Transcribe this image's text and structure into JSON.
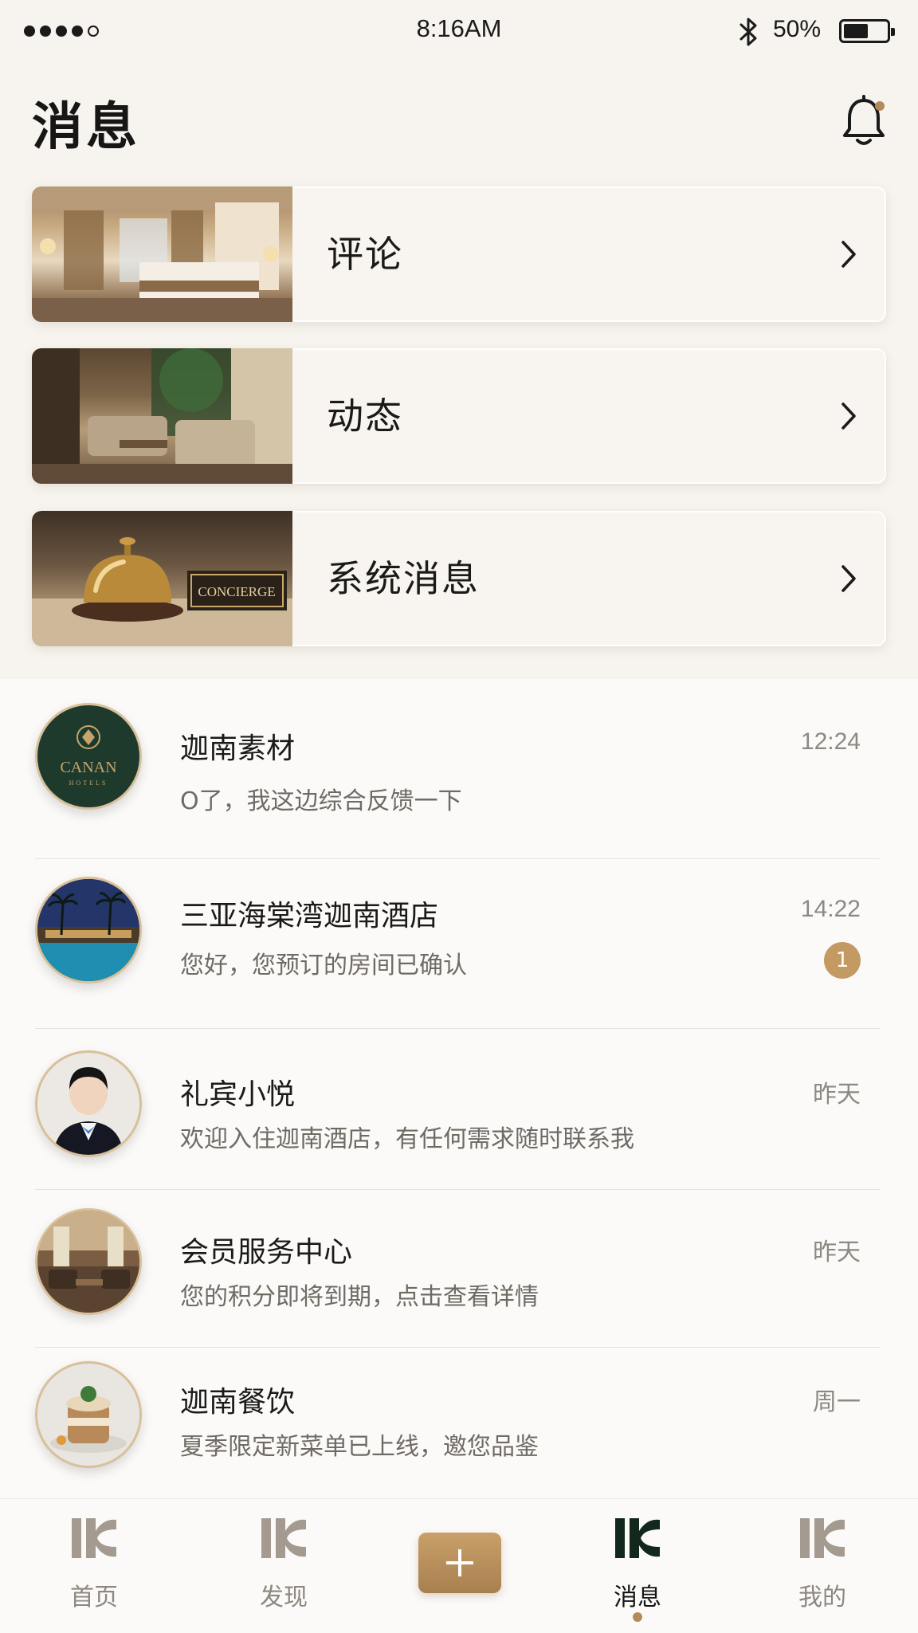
{
  "status_bar": {
    "time": "8:16AM",
    "battery_percent": "50%",
    "signal_bars_filled": 4,
    "signal_bars_total": 5,
    "battery_level": 0.5
  },
  "header": {
    "title": "消息",
    "bell_icon": "bell-icon",
    "has_notification_dot": true
  },
  "categories": [
    {
      "label": "评论",
      "image": "hotel-room-image"
    },
    {
      "label": "动态",
      "image": "hotel-lobby-image"
    },
    {
      "label": "系统消息",
      "image": "concierge-bell-image",
      "image_text": "CONCIERGE"
    }
  ],
  "messages": [
    {
      "name": "迦南素材",
      "preview": "O了，我这边综合反馈一下",
      "time": "12:24",
      "avatar": "canan-hotels-logo",
      "avatar_text": "CANAN",
      "avatar_subtext": "HOTELS"
    },
    {
      "name": "三亚海棠湾迦南酒店",
      "preview": "您好，您预订的房间已确认",
      "time": "14:22",
      "badge": "1",
      "avatar": "resort-pool-photo"
    },
    {
      "name": "礼宾小悦",
      "preview": "欢迎入住迦南酒店，有任何需求随时联系我",
      "time": "昨天",
      "avatar": "concierge-staff-photo"
    },
    {
      "name": "会员服务中心",
      "preview": "您的积分即将到期，点击查看详情",
      "time": "昨天",
      "avatar": "lounge-photo"
    },
    {
      "name": "迦南餐饮",
      "preview": "夏季限定新菜单已上线，邀您品鉴",
      "time": "周一",
      "avatar": "dessert-photo"
    }
  ],
  "tab_bar": {
    "tabs": [
      {
        "label": "首页",
        "icon": "kc-logo-icon",
        "active": false
      },
      {
        "label": "发现",
        "icon": "kc-logo-icon",
        "active": false
      },
      {
        "label": "消息",
        "icon": "kc-logo-icon",
        "active": true
      },
      {
        "label": "我的",
        "icon": "kc-logo-icon",
        "active": false
      }
    ],
    "add_icon": "plus-icon"
  },
  "colors": {
    "accent_gold": "#b48a57",
    "badge": "#c49a63",
    "background": "#f7f4ef",
    "active_icon": "#1f3a2c",
    "inactive_icon": "#a49a90"
  }
}
